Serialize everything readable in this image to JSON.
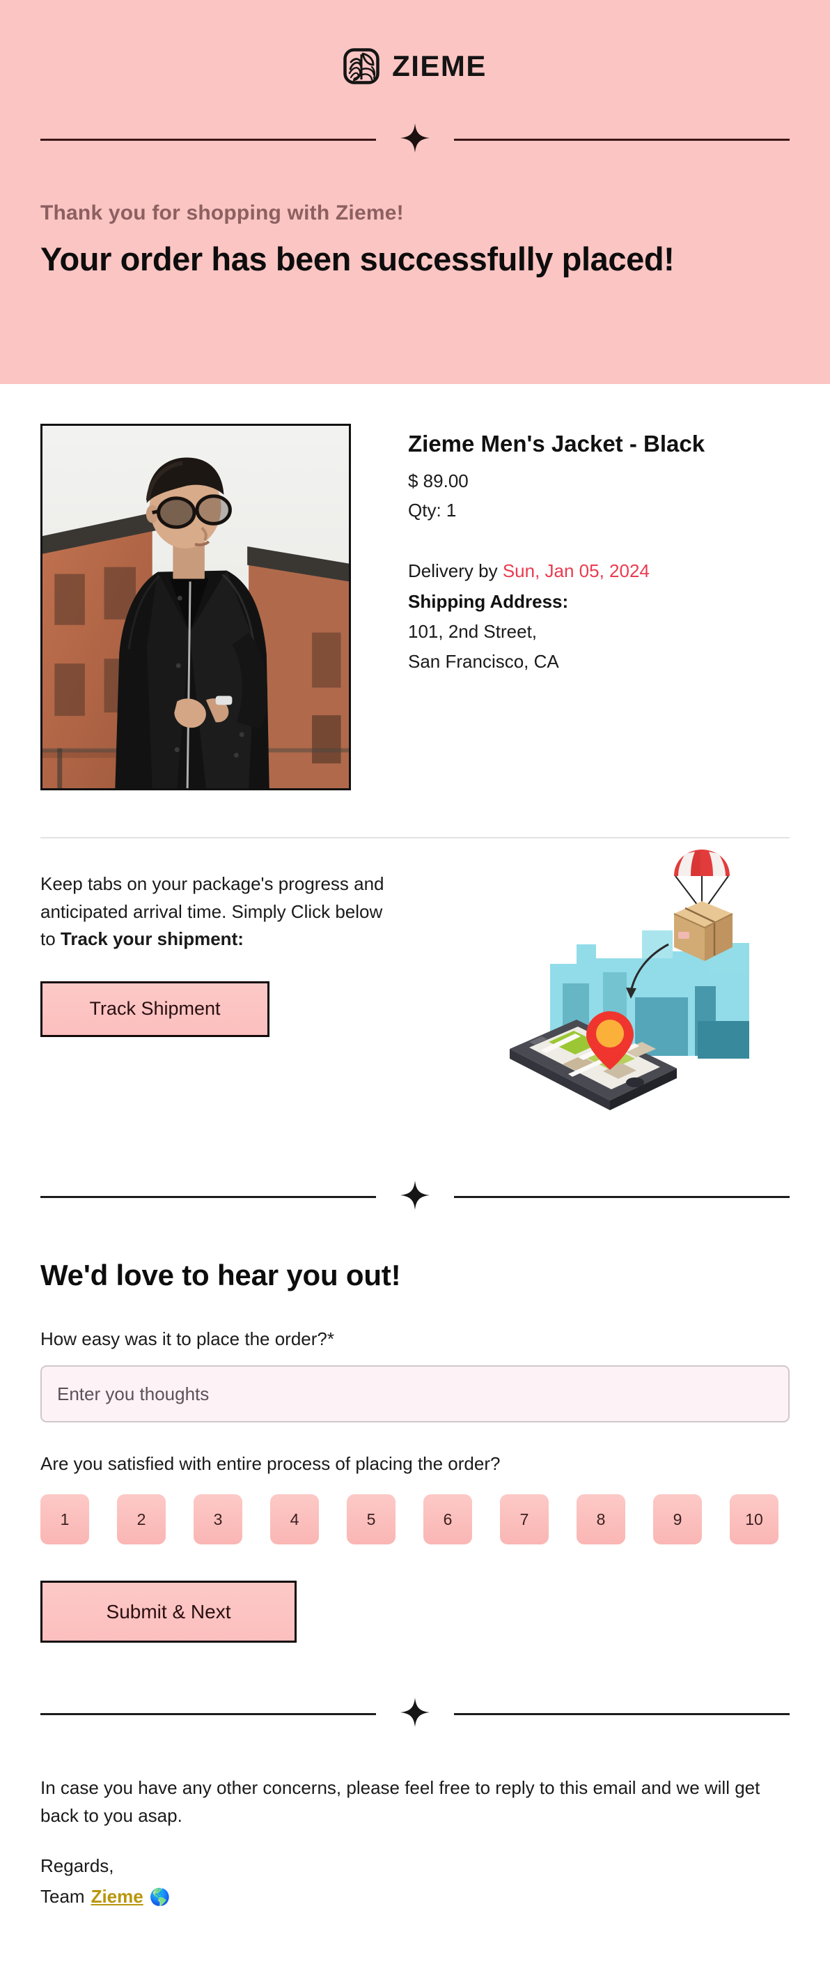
{
  "brand": {
    "name": "ZIEME",
    "logo_icon": "leaf-fingerprint-logo-icon"
  },
  "colors": {
    "header_bg": "#fbc5c3",
    "accent_pink": "#fbbfbe",
    "delivery_red": "#ea3b4f",
    "link_gold": "#b8960b",
    "body_bg": "#ffffff"
  },
  "header": {
    "eyebrow": "Thank you for shopping with Zieme!",
    "headline": "Your order has been successfully placed!"
  },
  "product": {
    "image_alt": "man-in-black-jacket-photo",
    "title": "Zieme Men's Jacket - Black",
    "price": "$ 89.00",
    "qty": "Qty: 1",
    "delivery_prefix": "Delivery by ",
    "delivery_date": "Sun, Jan 05, 2024",
    "shipping_label": "Shipping Address:",
    "address_line_1": "101, 2nd Street,",
    "address_line_2": "San Francisco, CA"
  },
  "tracking": {
    "copy_part_1": "Keep tabs on your package's progress and anticipated arrival time. Simply Click below to ",
    "copy_bold": "Track your shipment:",
    "button_label": "Track Shipment",
    "illustration": "parcel-parachute-map-phone-illustration"
  },
  "feedback": {
    "title": "We'd love to hear you out!",
    "question_1": "How easy was it to place the order?*",
    "input_placeholder": "Enter you thoughts",
    "input_value": "",
    "question_2": "Are you satisfied with entire process of placing the order?",
    "rating_options": [
      "1",
      "2",
      "3",
      "4",
      "5",
      "6",
      "7",
      "8",
      "9",
      "10"
    ],
    "submit_label": "Submit & Next"
  },
  "footer": {
    "body": "In case you have any other concerns, please feel free to reply to this email and we will get back to you asap.",
    "regards": "Regards,",
    "team_prefix": "Team",
    "team_link": "Zieme",
    "globe_icon": "🌎"
  }
}
